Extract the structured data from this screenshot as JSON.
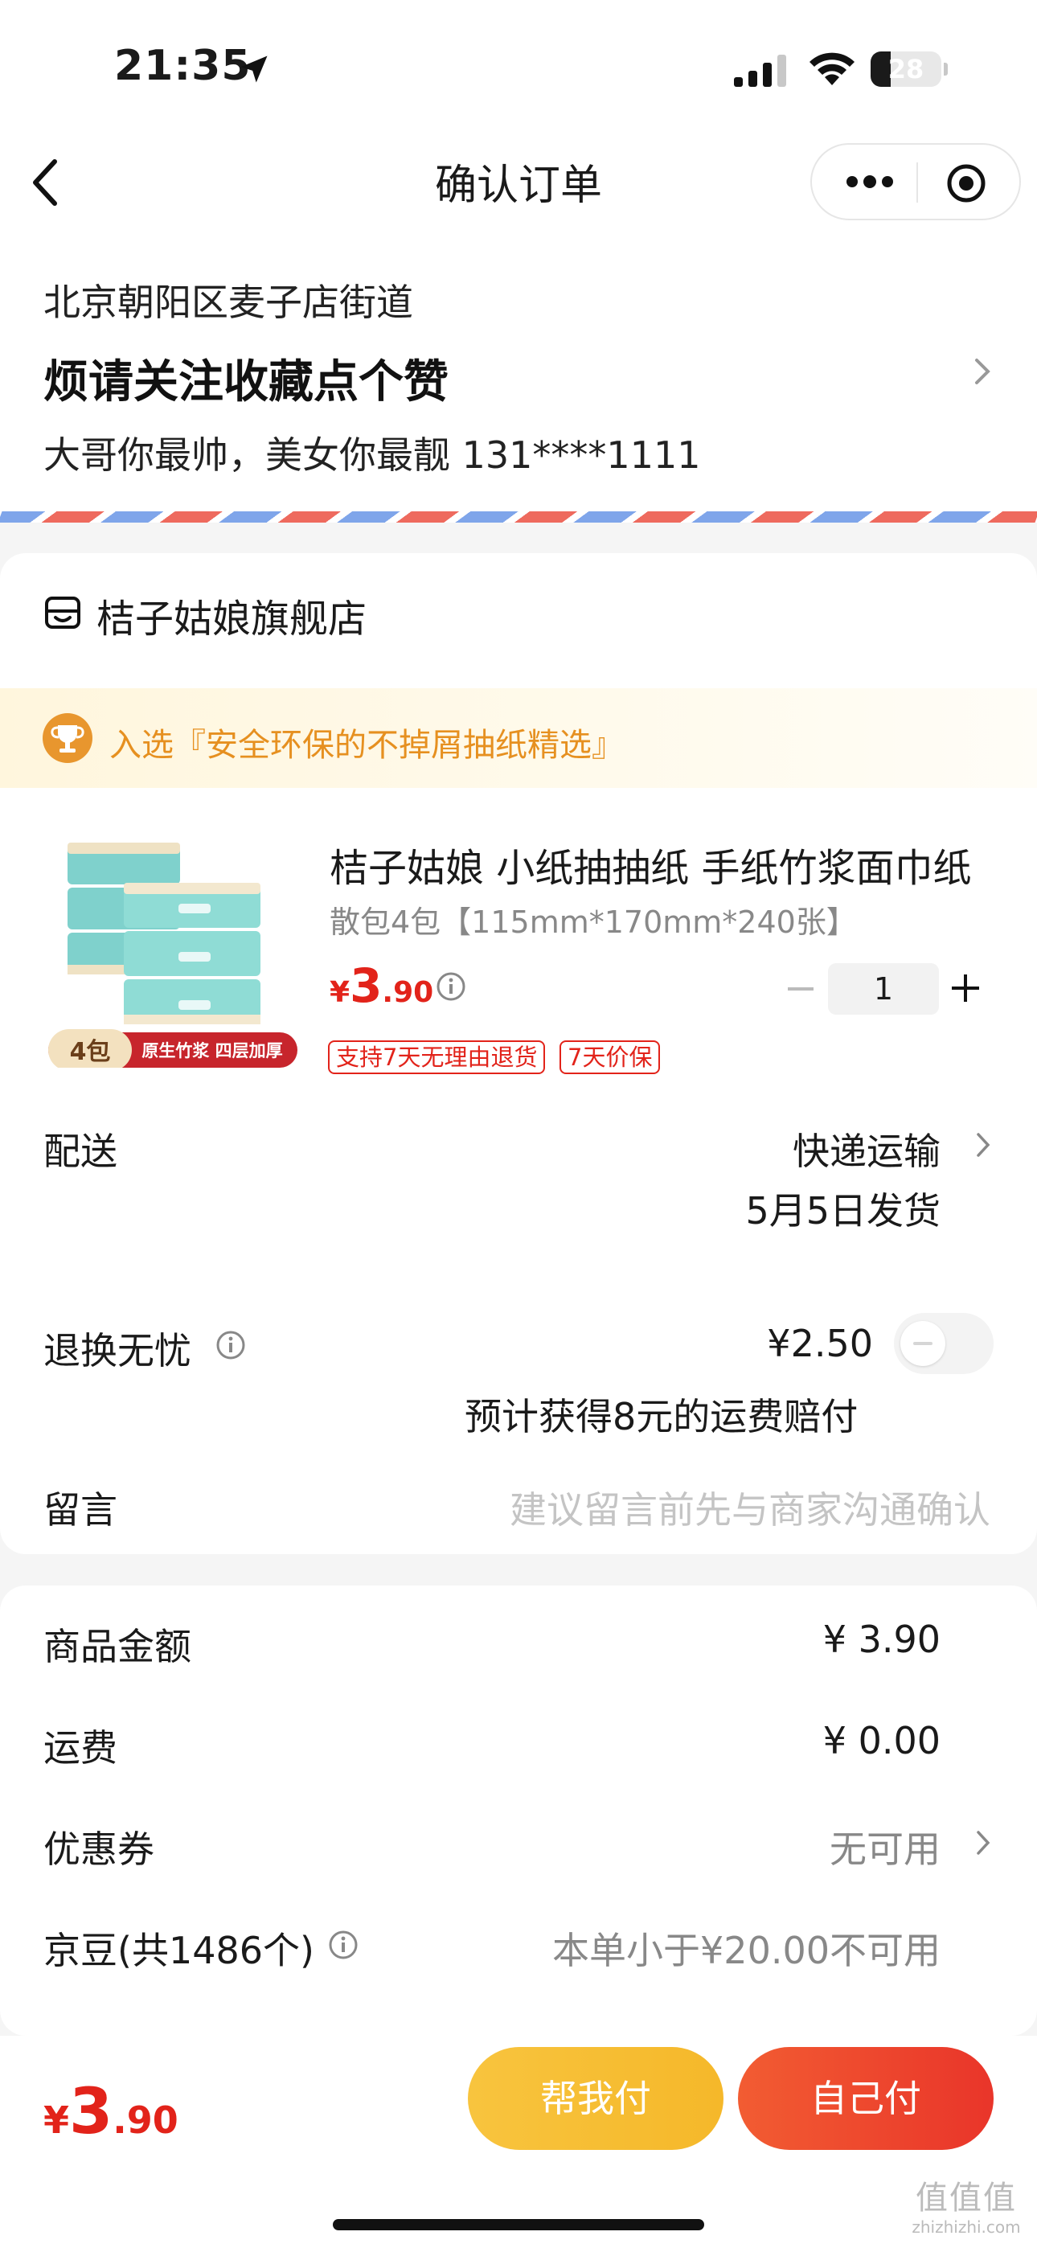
{
  "status_bar": {
    "time": "21:35",
    "battery": "28",
    "battery_fraction": 0.28
  },
  "nav": {
    "title": "确认订单",
    "back_icon": "chevron-left-icon",
    "more_icon": "more-dots-icon",
    "close_icon": "target-close-icon"
  },
  "address": {
    "region": "北京朝阳区麦子店街道",
    "detail": "烦请关注收藏点个赞",
    "contact": "大哥你最帅，美女你最靓 131****1111"
  },
  "store": {
    "name": "桔子姑娘旗舰店",
    "award": "入选『安全环保的不掉屑抽纸精选』",
    "product": {
      "title": "桔子姑娘 小纸抽抽纸 手纸竹浆面巾纸",
      "spec": "散包4包【115mm*170mm*240张】",
      "price_currency": "¥",
      "price_int": "3",
      "price_dec": ".90",
      "quantity": "1",
      "tags": [
        "支持7天无理由退货",
        "7天价保"
      ],
      "image_badge_count": "4包",
      "image_badge_text": "原生竹浆 四层加厚"
    },
    "delivery": {
      "label": "配送",
      "value": "快递运输",
      "date": "5月5日发货"
    },
    "return": {
      "label": "退换无忧",
      "price": "¥2.50",
      "note": "预计获得8元的运费赔付",
      "enabled": false
    },
    "message": {
      "label": "留言",
      "placeholder": "建议留言前先与商家沟通确认"
    }
  },
  "summary": {
    "goods_label": "商品金额",
    "goods_value": "¥ 3.90",
    "shipping_label": "运费",
    "shipping_value": "¥ 0.00",
    "coupon_label": "优惠券",
    "coupon_value": "无可用",
    "beans_label": "京豆(共1486个)",
    "beans_value": "本单小于¥20.00不可用"
  },
  "bottom": {
    "total_currency": "¥",
    "total_int": "3",
    "total_dec": ".90",
    "pay_friend_label": "帮我付",
    "pay_self_label": "自己付",
    "watermark_logo": "值值值",
    "watermark_url": "zhizhizhi.com"
  },
  "colors": {
    "accent_red": "#e2231a",
    "award_orange": "#e69020",
    "pay_friend": "#f6bd31",
    "pay_self": "#ee4630"
  }
}
